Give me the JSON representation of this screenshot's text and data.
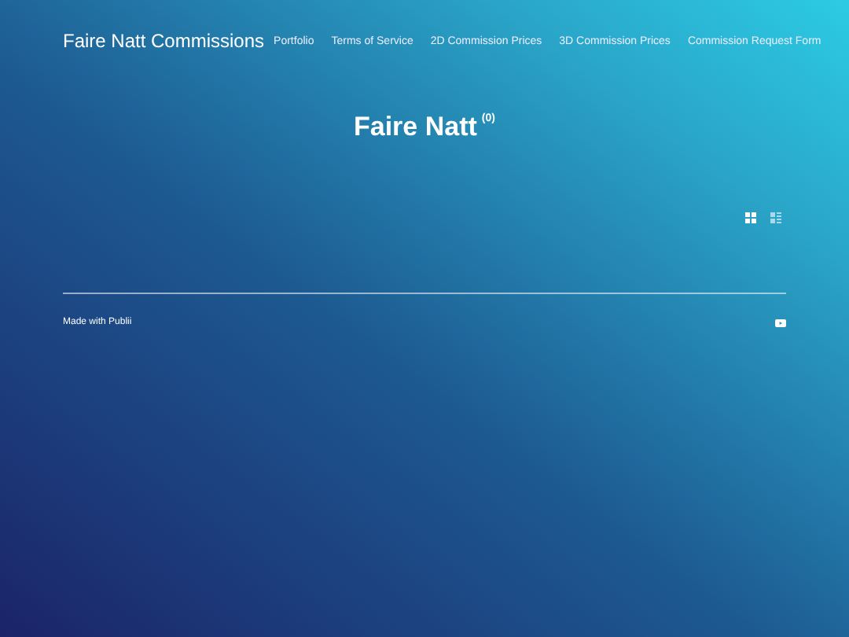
{
  "header": {
    "brand": "Faire Natt Commissions",
    "nav": [
      {
        "label": "Portfolio"
      },
      {
        "label": "Terms of Service"
      },
      {
        "label": "2D Commission Prices"
      },
      {
        "label": "3D Commission Prices"
      },
      {
        "label": "Commission Request Form"
      }
    ]
  },
  "gallery": {
    "title": "Faire Natt",
    "count": "(0)",
    "views": [
      {
        "kind": "grid",
        "selected": true
      },
      {
        "kind": "list",
        "selected": false
      }
    ]
  },
  "footer": {
    "credit": "Made with Publii"
  }
}
